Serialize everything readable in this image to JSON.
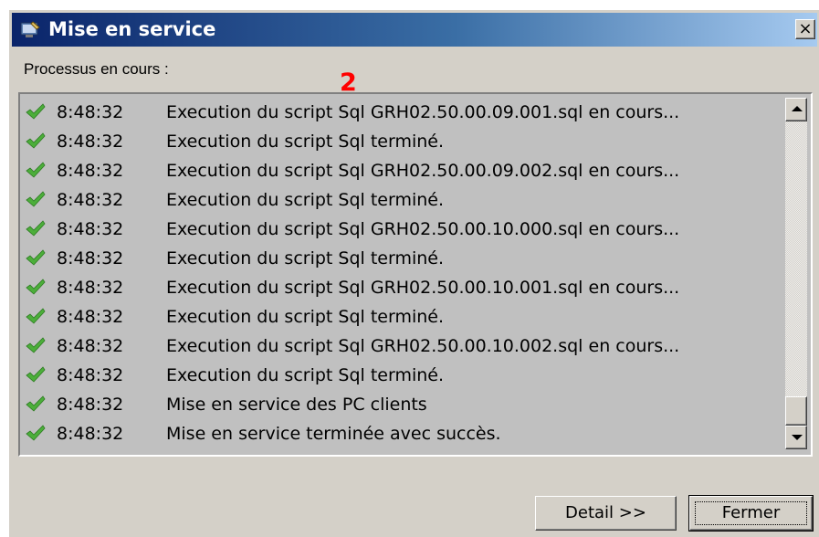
{
  "window": {
    "title": "Mise en service",
    "close_label": "×",
    "icon": "setup-app-icon"
  },
  "section_label": "Processus en cours :",
  "annotation_marker": "2",
  "log": {
    "icon": "checkmark-icon",
    "entries": [
      {
        "time": "8:48:32",
        "message": "Execution du script Sql GRH02.50.00.09.001.sql en cours..."
      },
      {
        "time": "8:48:32",
        "message": "Execution du script Sql terminé."
      },
      {
        "time": "8:48:32",
        "message": "Execution du script Sql GRH02.50.00.09.002.sql en cours..."
      },
      {
        "time": "8:48:32",
        "message": "Execution du script Sql terminé."
      },
      {
        "time": "8:48:32",
        "message": "Execution du script Sql GRH02.50.00.10.000.sql en cours..."
      },
      {
        "time": "8:48:32",
        "message": "Execution du script Sql terminé."
      },
      {
        "time": "8:48:32",
        "message": "Execution du script Sql GRH02.50.00.10.001.sql en cours..."
      },
      {
        "time": "8:48:32",
        "message": "Execution du script Sql terminé."
      },
      {
        "time": "8:48:32",
        "message": "Execution du script Sql GRH02.50.00.10.002.sql en cours..."
      },
      {
        "time": "8:48:32",
        "message": "Execution du script Sql terminé."
      },
      {
        "time": "8:48:32",
        "message": "Mise en service des PC clients"
      },
      {
        "time": "8:48:32",
        "message": "Mise en service terminée avec succès."
      }
    ]
  },
  "buttons": {
    "detail_label": "Detail >>",
    "close_label": "Fermer"
  },
  "colors": {
    "check_green": "#4cae3a",
    "marker_red": "#ff0000",
    "dialog_face": "#d4d0c8"
  }
}
